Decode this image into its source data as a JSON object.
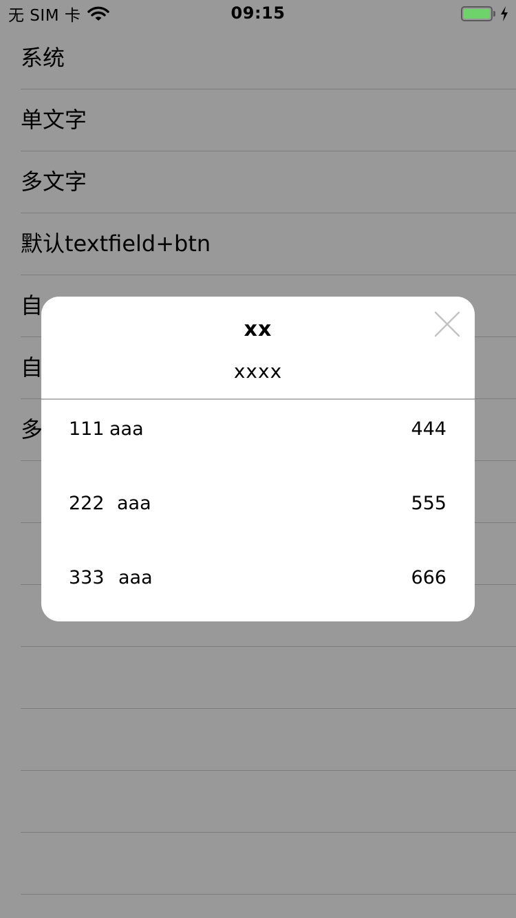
{
  "status_bar": {
    "carrier": "无 SIM 卡",
    "time": "09:15",
    "battery_level": 1.0,
    "charging": true,
    "battery_color": "#6fd36b"
  },
  "list": {
    "items": [
      {
        "label": "系统"
      },
      {
        "label": "单文字"
      },
      {
        "label": "多文字"
      },
      {
        "label": "默认textfield+btn"
      },
      {
        "label": "自"
      },
      {
        "label": "自"
      },
      {
        "label": "多"
      },
      {
        "label": ""
      },
      {
        "label": ""
      },
      {
        "label": ""
      },
      {
        "label": ""
      },
      {
        "label": ""
      },
      {
        "label": ""
      },
      {
        "label": ""
      }
    ]
  },
  "modal": {
    "title": "xx",
    "subtitle": "xxxx",
    "close_icon": "close-icon",
    "rows": [
      {
        "a": "111",
        "b": "aaa",
        "c": "444"
      },
      {
        "a": "222",
        "b": "aaa",
        "c": "555"
      },
      {
        "a": "333",
        "b": "aaa",
        "c": "666"
      }
    ]
  },
  "colors": {
    "dim_background": "#999999",
    "modal_background": "#ffffff",
    "separator": "#7c7c7c"
  }
}
